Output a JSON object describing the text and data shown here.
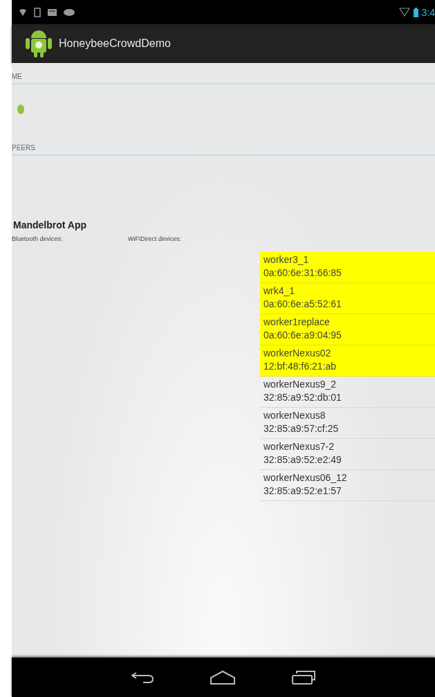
{
  "status_bar": {
    "time": "3:4"
  },
  "action_bar": {
    "title": "HoneybeeCrowdDemo"
  },
  "sections": [
    {
      "header": "ME"
    },
    {
      "header": "PEERS"
    }
  ],
  "app_title": "Mandelbrot App",
  "bluetooth_label": "Bluetooth devices:",
  "wifi_label": "WiFiDirect devices:",
  "wifi_devices": [
    {
      "name": "worker3_1",
      "address": "0a:60:6e:31:66:85",
      "selected": true
    },
    {
      "name": "wrk4_1",
      "address": "0a:60:6e:a5:52:61",
      "selected": true
    },
    {
      "name": "worker1replace",
      "address": "0a:60:6e:a9:04:95",
      "selected": true
    },
    {
      "name": "workerNexus02",
      "address": "12:bf:48:f6:21:ab",
      "selected": true
    },
    {
      "name": "workerNexus9_2",
      "address": "32:85:a9:52:db:01",
      "selected": false
    },
    {
      "name": "workerNexus8",
      "address": "32:85:a9:57:cf:25",
      "selected": false
    },
    {
      "name": "workerNexus7-2",
      "address": "32:85:a9:52:e2:49",
      "selected": false
    },
    {
      "name": "workerNexus06_12",
      "address": "32:85:a9:52:e1:57",
      "selected": false
    }
  ]
}
